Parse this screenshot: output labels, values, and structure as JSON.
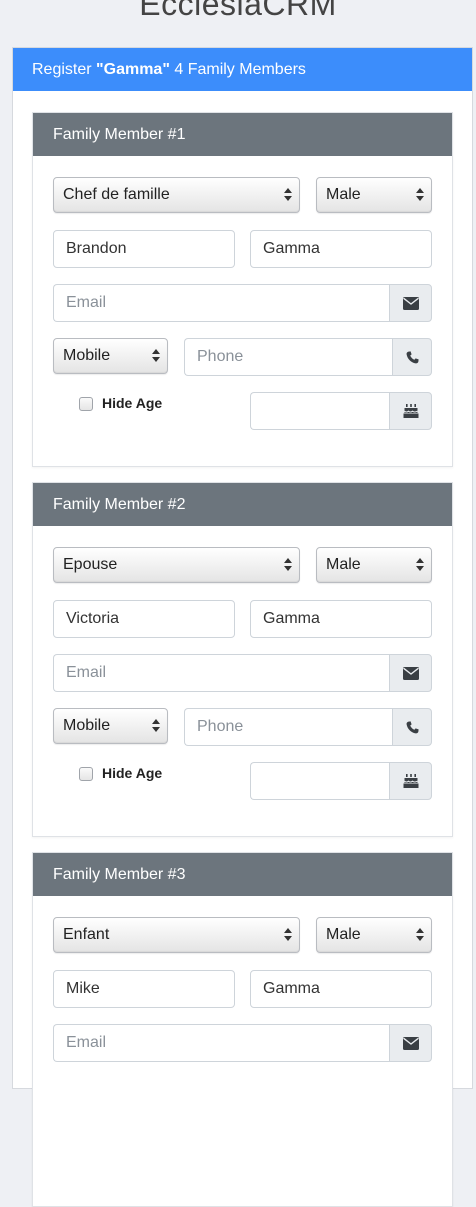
{
  "app": {
    "logo_main": "Ecclesia",
    "logo_suffix": "CRM"
  },
  "register": {
    "prefix": "Register ",
    "family_name": "\"Gamma\"",
    "suffix": " 4 Family Members"
  },
  "members": [
    {
      "title": "Family Member #1",
      "role": "Chef de famille",
      "gender": "Male",
      "first_name": "Brandon",
      "last_name": "Gamma",
      "email_placeholder": "Email",
      "phone_type": "Mobile",
      "phone_placeholder": "Phone",
      "hide_age_label": "Hide Age",
      "birthday": ""
    },
    {
      "title": "Family Member #2",
      "role": "Epouse",
      "gender": "Male",
      "first_name": "Victoria",
      "last_name": "Gamma",
      "email_placeholder": "Email",
      "phone_type": "Mobile",
      "phone_placeholder": "Phone",
      "hide_age_label": "Hide Age",
      "birthday": ""
    },
    {
      "title": "Family Member #3",
      "role": "Enfant",
      "gender": "Male",
      "first_name": "Mike",
      "last_name": "Gamma",
      "email_placeholder": "Email"
    }
  ],
  "icons": {
    "email": "envelope-icon",
    "phone": "phone-icon",
    "birthday": "birthday-cake-icon",
    "select": "select-arrows-icon"
  },
  "colors": {
    "header_blue": "#3c8dfb",
    "card_header_gray": "#6c757d",
    "background": "#eef0f4"
  }
}
